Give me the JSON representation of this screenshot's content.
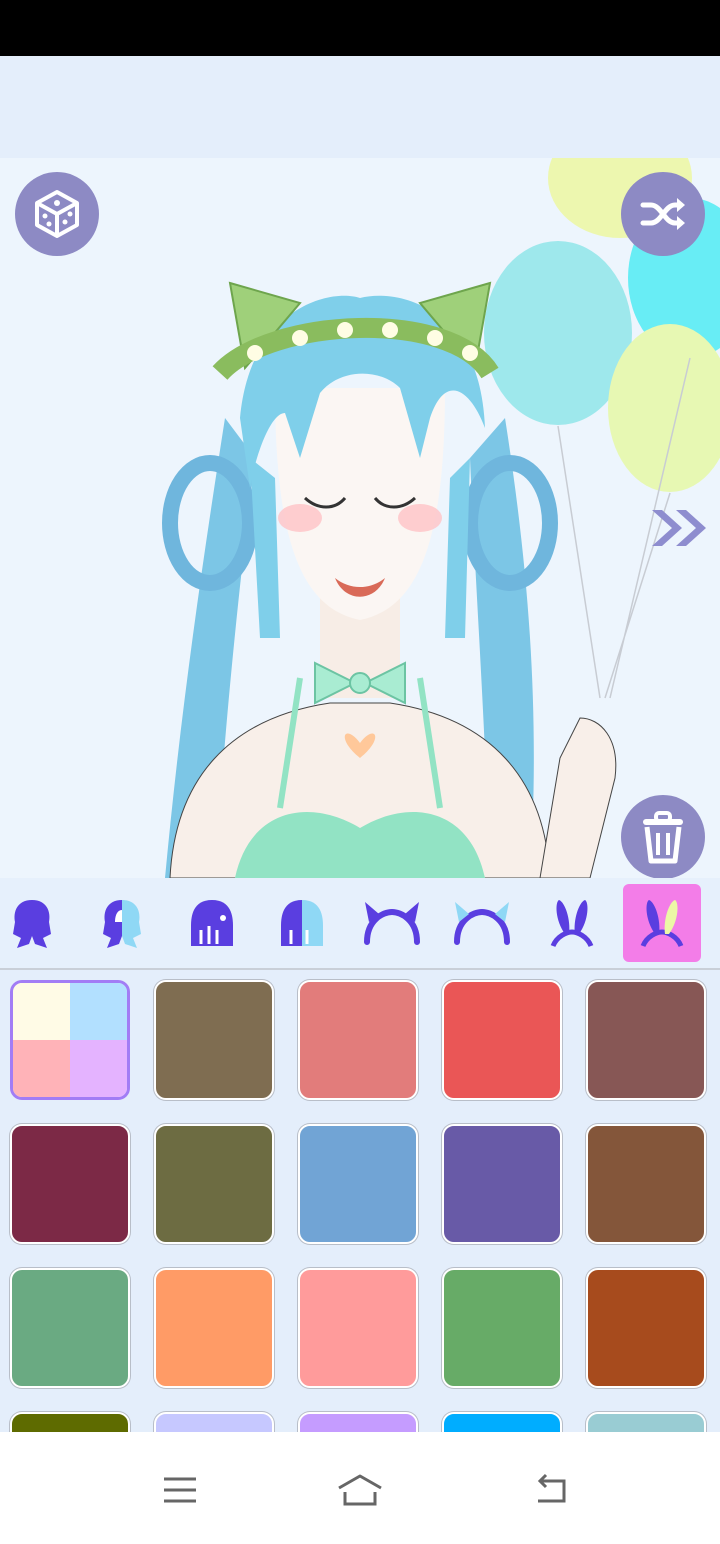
{
  "app": {
    "screen": "avatar-maker-editor",
    "accent_color": "#8d8ac4",
    "selected_accent": "#f37de8"
  },
  "canvas": {
    "background": "#edf5fd",
    "controls": {
      "randomize_icon": "dice-icon",
      "shuffle_icon": "shuffle-icon",
      "next_icon": "double-chevron-right-icon",
      "delete_icon": "trash-icon"
    }
  },
  "categories": [
    {
      "icon": "long-hair-icon",
      "selected": false
    },
    {
      "icon": "long-hair-two-tone-icon",
      "selected": false
    },
    {
      "icon": "short-hair-icon",
      "selected": false
    },
    {
      "icon": "short-hair-two-tone-icon",
      "selected": false
    },
    {
      "icon": "horns-headband-icon",
      "selected": false
    },
    {
      "icon": "horns-headband-two-tone-icon",
      "selected": false
    },
    {
      "icon": "bunny-ears-icon",
      "selected": false
    },
    {
      "icon": "bunny-ears-two-tone-icon",
      "selected": true
    }
  ],
  "swatches": [
    {
      "kind": "multi",
      "colors": [
        "#fffbe6",
        "#b2e0ff",
        "#ffb3b8",
        "#e4b3ff"
      ],
      "selected": true
    },
    {
      "kind": "solid",
      "color": "#7f6d51"
    },
    {
      "kind": "solid",
      "color": "#e27c7b"
    },
    {
      "kind": "solid",
      "color": "#ea5656"
    },
    {
      "kind": "solid",
      "color": "#875755"
    },
    {
      "kind": "solid",
      "color": "#7c2946"
    },
    {
      "kind": "solid",
      "color": "#6d6c42"
    },
    {
      "kind": "solid",
      "color": "#71a4d5"
    },
    {
      "kind": "solid",
      "color": "#685aa7"
    },
    {
      "kind": "solid",
      "color": "#84563a"
    },
    {
      "kind": "solid",
      "color": "#6aaa82"
    },
    {
      "kind": "solid",
      "color": "#ff9b66"
    },
    {
      "kind": "solid",
      "color": "#ff9b9b"
    },
    {
      "kind": "solid",
      "color": "#67ab67"
    },
    {
      "kind": "solid",
      "color": "#a74b1d"
    },
    {
      "kind": "solid",
      "color": "#5e6b00"
    },
    {
      "kind": "solid",
      "color": "#c6c8ff"
    },
    {
      "kind": "solid",
      "color": "#c59cff"
    },
    {
      "kind": "solid",
      "color": "#00adff"
    },
    {
      "kind": "solid",
      "color": "#99ccd3"
    }
  ],
  "nav": {
    "menu_icon": "menu-icon",
    "home_icon": "home-icon",
    "back_icon": "back-icon"
  }
}
